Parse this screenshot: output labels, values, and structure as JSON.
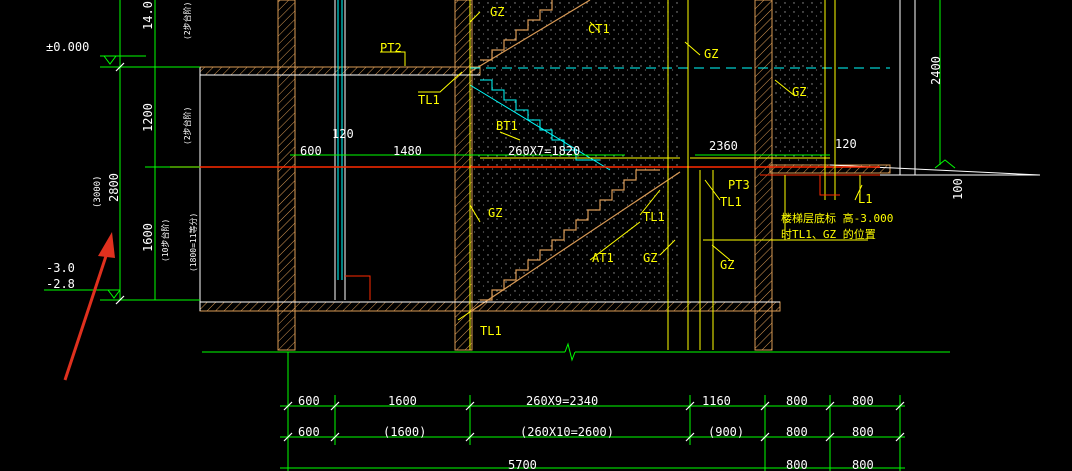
{
  "labels": {
    "elev_zero": "±0.000",
    "elev_m3": "-3.0",
    "elev_m28": "-2.8",
    "dim_14": "14.0",
    "dim_1200": "1200",
    "dim_2800": "2800",
    "dim_3000": "(3000)",
    "dim_1600": "1600",
    "note_top": "(2步台阶)",
    "note_mid": "(2步台阶)",
    "note_low": "(10步台阶)",
    "note_low2": "(1800=11等分)",
    "pt2": "PT2",
    "gz_top": "GZ",
    "ct1": "CT1",
    "gz_mid": "GZ",
    "gz_right": "GZ",
    "tl1_a": "TL1",
    "bt1": "BT1",
    "d120a": "120",
    "d600": "600",
    "d1480": "1480",
    "d260x7": "260X7=1820",
    "d2360": "2360",
    "d120b": "120",
    "pt3": "PT3",
    "tl1_b": "TL1",
    "tl1_c": "TL1",
    "l1": "L1",
    "note_red1": "楼梯层底标    高-3.000",
    "note_red2": "时TL1、GZ 的位置",
    "gz_left": "GZ",
    "at1": "AT1",
    "gz_b1": "GZ",
    "gz_b2": "GZ",
    "tl1_d": "TL1",
    "d2400": "2400",
    "d100": "100"
  },
  "dim_row1": [
    "600",
    "1600",
    "260X9=2340",
    "1160",
    "800",
    "800"
  ],
  "dim_row2": [
    "600",
    "(1600)",
    "(260X10=2600)",
    "(900)",
    "800",
    "800"
  ],
  "dim_row3": [
    "5700",
    "800",
    "800"
  ],
  "colors": {
    "yellow": "#ffff00",
    "green": "#00ff00",
    "white": "#ffffff",
    "red": "#ff2a00",
    "cyan": "#00ffff",
    "orange": "#d99a55",
    "arrow": "#e0301e"
  }
}
